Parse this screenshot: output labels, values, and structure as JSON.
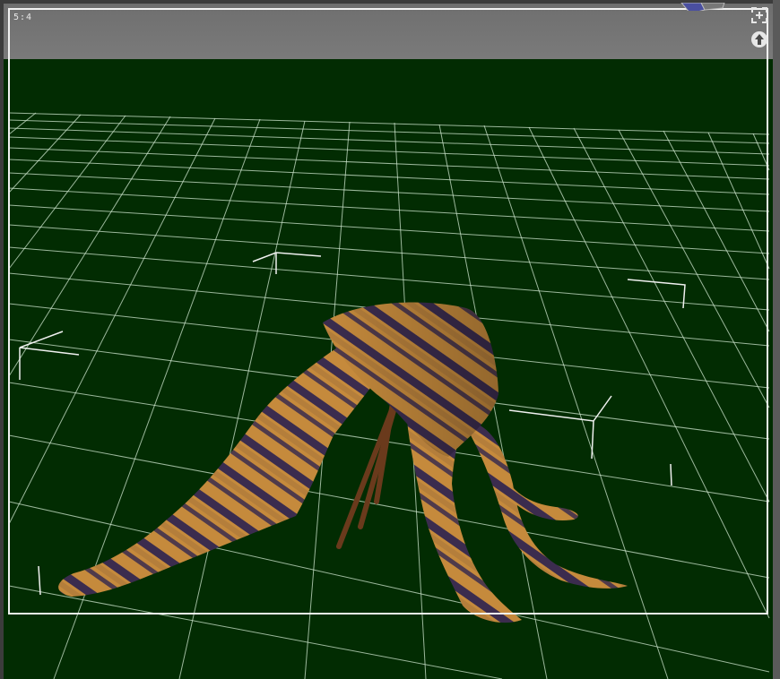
{
  "viewport": {
    "aspect_label": "5:4",
    "background_color": "#022c02",
    "grid_color": "#cfe6cf",
    "frame_color": "#f2f2f2"
  },
  "controls": {
    "maximize_icon": "maximize-icon",
    "up_icon": "arrow-up-icon"
  },
  "model": {
    "texture": "tiger-stripe",
    "base_color": "#c58a3c",
    "stripe_color": "#3b2c4e"
  }
}
